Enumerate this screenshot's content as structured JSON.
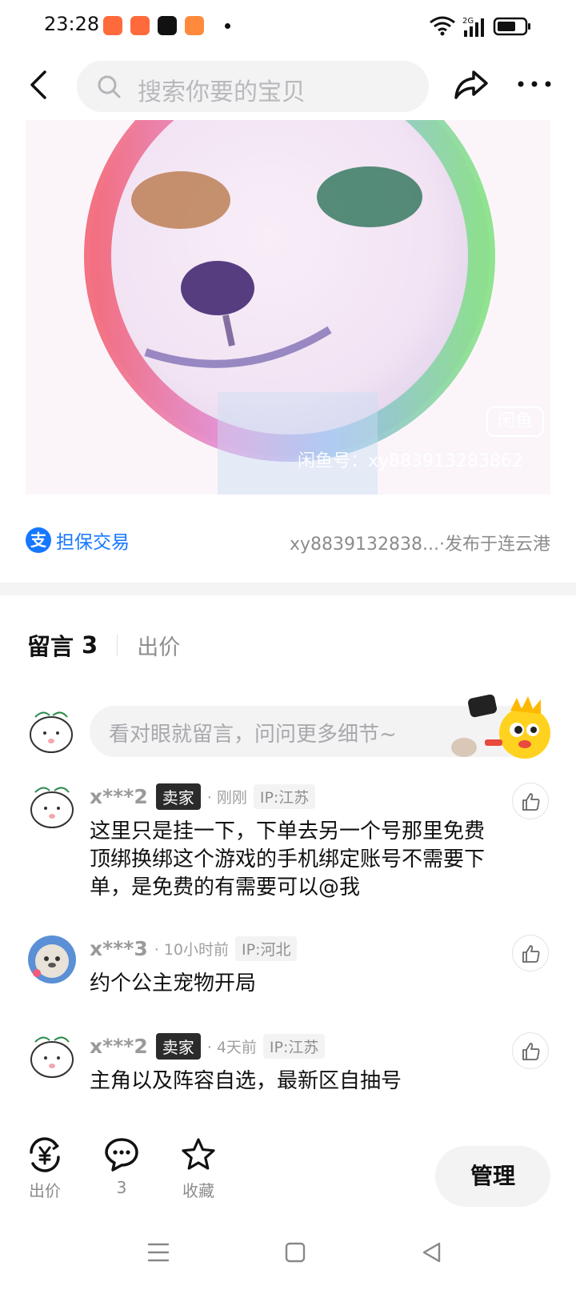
{
  "status_bar": {
    "time": "23:28",
    "network": "2G"
  },
  "search": {
    "placeholder": "搜索你要的宝贝"
  },
  "listing": {
    "watermark_badge": "闲鱼",
    "watermark_text": "闲鱼号：xy883913283862",
    "guarantee_label": "担保交易",
    "alipay_glyph": "支",
    "publish_info": "xy8839132838...·发布于连云港"
  },
  "tabs": {
    "comments_label": "留言",
    "comments_count": "3",
    "bid_label": "出价"
  },
  "comment_input": {
    "placeholder": "看对眼就留言，问问更多细节~"
  },
  "comments": [
    {
      "user": "x***2",
      "badge": "卖家",
      "time": "· 刚刚",
      "ip": "IP:江苏",
      "text": "这里只是挂一下，下单去另一个号那里免费顶绑换绑这个游戏的手机绑定账号不需要下单，是免费的有需要可以@我"
    },
    {
      "user": "x***3",
      "time": "· 10小时前",
      "ip": "IP:河北",
      "text": "约个公主宠物开局"
    },
    {
      "user": "x***2",
      "badge": "卖家",
      "time": "· 4天前",
      "ip": "IP:江苏",
      "text": "主角以及阵容自选，最新区自抽号"
    }
  ],
  "bottom_bar": {
    "bid_label": "出价",
    "comment_count": "3",
    "favorite_label": "收藏",
    "manage_label": "管理"
  },
  "colors": {
    "accent_blue": "#1677ff",
    "seller_badge": "#2b2b2b",
    "input_bg": "#f3f3f4"
  },
  "icons": [
    "back-icon",
    "search-icon",
    "share-icon",
    "more-icon",
    "alipay-icon",
    "like-icon",
    "bid-icon",
    "comment-icon",
    "star-icon",
    "nav-menu-icon",
    "nav-home-icon",
    "nav-back-icon"
  ]
}
